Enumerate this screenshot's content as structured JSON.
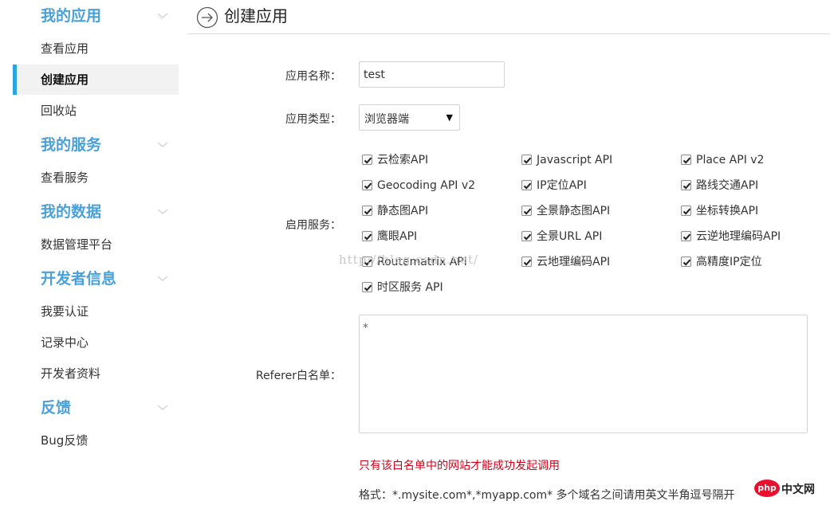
{
  "sidebar": {
    "sections": [
      {
        "title": "我的应用",
        "items": [
          "查看应用",
          "创建应用",
          "回收站"
        ]
      },
      {
        "title": "我的服务",
        "items": [
          "查看服务"
        ]
      },
      {
        "title": "我的数据",
        "items": [
          "数据管理平台"
        ]
      },
      {
        "title": "开发者信息",
        "items": [
          "我要认证",
          "记录中心",
          "开发者资料"
        ]
      },
      {
        "title": "反馈",
        "items": [
          "Bug反馈"
        ]
      }
    ],
    "active_item": "创建应用"
  },
  "header": {
    "title": "创建应用",
    "icon": "arrow-circle-right-icon"
  },
  "form": {
    "app_name_label": "应用名称：",
    "app_name_value": "test",
    "app_type_label": "应用类型：",
    "app_type_value": "浏览器端",
    "services_label": "启用服务：",
    "services": [
      "云检索API",
      "Javascript API",
      "Place API v2",
      "Geocoding API v2",
      "IP定位API",
      "路线交通API",
      "静态图API",
      "全景静态图API",
      "坐标转换API",
      "鹰眼API",
      "全景URL API",
      "云逆地理编码API",
      "Routematrix API",
      "云地理编码API",
      "高精度IP定位",
      "时区服务 API"
    ],
    "referer_label": "Referer白名单：",
    "referer_value": "*",
    "warning": "只有该白名单中的网站才能成功发起调用",
    "format_hint": "格式：*.mysite.com*,*myapp.com* 多个域名之间请用英文半角逗号隔开"
  },
  "watermark": "http://blog.csdn.net/",
  "logo": {
    "badge": "php",
    "text": "中文网"
  },
  "colors": {
    "accent": "#4aa0d8",
    "active_bar": "#2ca6e0",
    "warning": "#d0021b"
  }
}
